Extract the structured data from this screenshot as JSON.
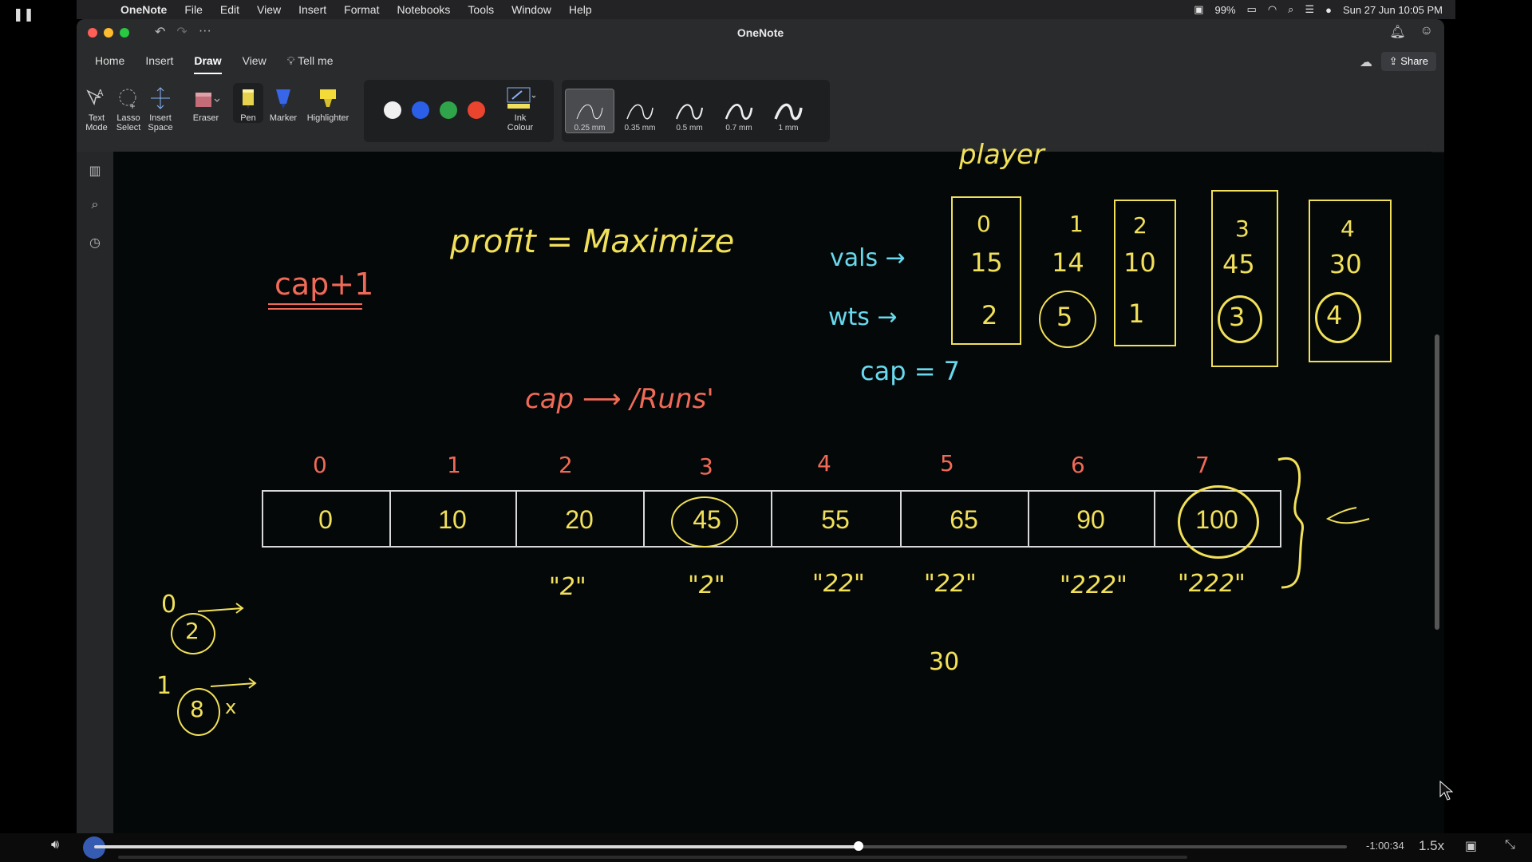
{
  "menubar": {
    "app_name": "OneNote",
    "items": [
      "File",
      "Edit",
      "View",
      "Insert",
      "Format",
      "Notebooks",
      "Tools",
      "Window",
      "Help"
    ],
    "battery": "99%",
    "datetime": "Sun 27 Jun  10:05 PM"
  },
  "window": {
    "title": "OneNote",
    "tabs": [
      "Home",
      "Insert",
      "Draw",
      "View"
    ],
    "active_tab": "Draw",
    "tell_me": "Tell me",
    "share_label": "Share"
  },
  "ribbon": {
    "text_mode": [
      "Text",
      "Mode"
    ],
    "lasso_select": [
      "Lasso",
      "Select"
    ],
    "insert_space": [
      "Insert",
      "Space"
    ],
    "eraser": "Eraser",
    "pen": "Pen",
    "marker": "Marker",
    "highlighter": "Highlighter",
    "ink_colour": [
      "Ink",
      "Colour"
    ],
    "colors": [
      "#f0f0f0",
      "#2c5fe8",
      "#2fa44a",
      "#e8442e"
    ],
    "thickness": [
      "0.25 mm",
      "0.35 mm",
      "0.5 mm",
      "0.7 mm",
      "1 mm"
    ],
    "selected_thickness": "0.25 mm"
  },
  "notes": {
    "player": "player",
    "profit": "profit = Maximize",
    "cap_plus_one": "cap+1",
    "cap_arrow": "cap ⟶ /Runs'",
    "vals_label": "vals →",
    "wts_label": "wts →",
    "cap_eq": "cap = 7",
    "items": [
      {
        "idx": "0",
        "val": "15",
        "wt": "2"
      },
      {
        "idx": "1",
        "val": "14",
        "wt": "5"
      },
      {
        "idx": "2",
        "val": "10",
        "wt": "1"
      },
      {
        "idx": "3",
        "val": "45",
        "wt": "3"
      },
      {
        "idx": "4",
        "val": "30",
        "wt": "4"
      }
    ],
    "dp_indices": [
      "0",
      "1",
      "2",
      "3",
      "4",
      "5",
      "6",
      "7"
    ],
    "dp_values": [
      "0",
      "10",
      "20",
      "45",
      "55",
      "65",
      "90",
      "100"
    ],
    "dp_subnotes": [
      "",
      "",
      "\"2\"",
      "\"2\"",
      "\"22\"",
      "\"22\"",
      "\"222\"",
      "\"222\""
    ],
    "thirty": "30",
    "left_notes": {
      "a_num": "0",
      "a_circle": "2",
      "b_num": "1",
      "b_circle": "8",
      "b_mark": "x"
    }
  },
  "video": {
    "time_remaining": "-1:00:34",
    "speed": "1.5x",
    "progress": 0.61
  }
}
